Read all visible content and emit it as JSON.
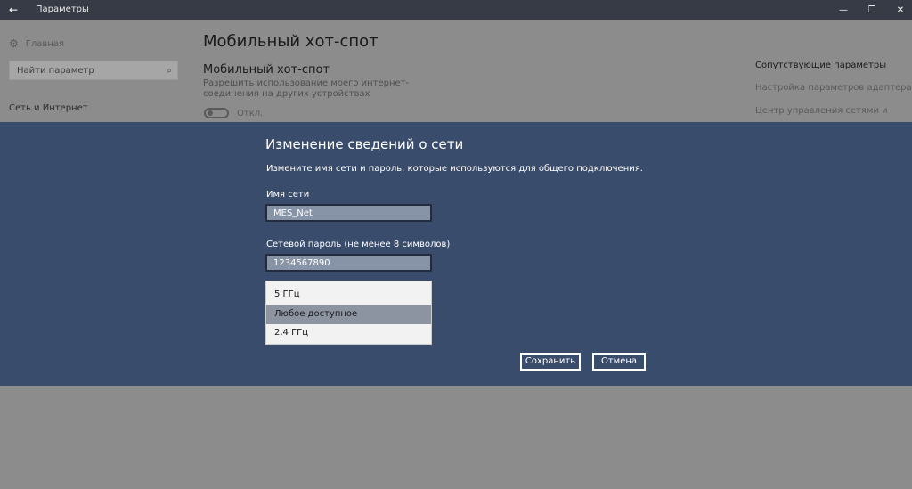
{
  "window": {
    "title": "Параметры",
    "back_glyph": "←",
    "minimize_glyph": "—",
    "maximize_glyph": "❐",
    "close_glyph": "✕"
  },
  "sidebar": {
    "home_label": "Главная",
    "search_placeholder": "Найти параметр",
    "section_label": "Сеть и Интернет"
  },
  "main": {
    "page_title": "Мобильный хот-спот",
    "subtitle": "Мобильный хот-спот",
    "description": "Разрешить использование моего интернет-соединения на других устройствах",
    "toggle_state": "Откл."
  },
  "related": {
    "title": "Сопутствующие параметры",
    "links": [
      "Настройка параметров адаптера",
      "Центр управления сетями и"
    ]
  },
  "dialog": {
    "title": "Изменение сведений о сети",
    "description": "Измените имя сети и пароль, которые используются для общего подключения.",
    "network_name_label": "Имя сети",
    "network_name_value": "MES_Net",
    "password_label": "Сетевой пароль (не менее 8 символов)",
    "password_value": "1234567890",
    "band_options": [
      "5 ГГц",
      "Любое доступное",
      "2,4 ГГц"
    ],
    "band_selected": "Любое доступное",
    "save_label": "Сохранить",
    "cancel_label": "Отмена"
  },
  "colors": {
    "titlebar": "#363b45",
    "modal_band": "#3a4c6b",
    "dim_page": "#8c8c8c",
    "selected_option": "#8c93a1"
  }
}
